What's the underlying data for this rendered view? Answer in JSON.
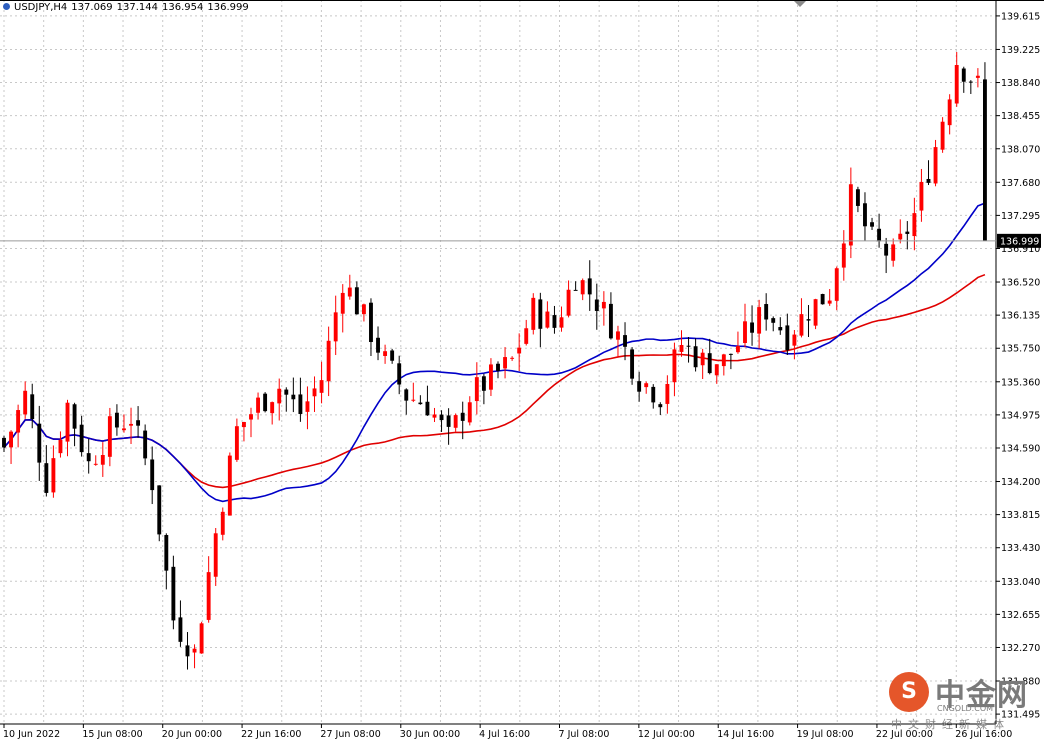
{
  "header": {
    "symbol": "USDJPY,H4",
    "open": "137.069",
    "high": "137.144",
    "low": "136.954",
    "close": "136.999"
  },
  "watermark": {
    "title": "中金网",
    "url": "CNGOLD.COM",
    "subtitle": "中文财经新媒体",
    "logo_glyph": "S"
  },
  "colors": {
    "bull": "#ff0000",
    "bear": "#000000",
    "ma_fast": "#0000c8",
    "ma_slow": "#e00000",
    "grid": "#c8c8c8",
    "current_badge_bg": "#000000",
    "current_badge_fg": "#ffffff"
  },
  "chart_data": {
    "type": "candlestick",
    "symbol": "USDJPY",
    "timeframe": "H4",
    "current_price": 136.999,
    "y_ticks": [
      "139.615",
      "139.225",
      "138.840",
      "138.455",
      "138.070",
      "137.680",
      "137.295",
      "136.910",
      "136.520",
      "136.135",
      "135.750",
      "135.360",
      "134.975",
      "134.590",
      "134.200",
      "133.815",
      "133.430",
      "133.040",
      "132.655",
      "132.270",
      "131.880",
      "131.495"
    ],
    "ylim": [
      131.38,
      139.8
    ],
    "x_ticks": [
      "10 Jun 2022",
      "15 Jun 08:00",
      "20 Jun 00:00",
      "22 Jun 16:00",
      "27 Jun 08:00",
      "30 Jun 00:00",
      "4 Jul 16:00",
      "7 Jul 08:00",
      "12 Jul 00:00",
      "14 Jul 16:00",
      "19 Jul 08:00",
      "22 Jul 00:00",
      "26 Jul 16:00"
    ],
    "candle_count": 140,
    "key_closes": [
      [
        0,
        134.6
      ],
      [
        3,
        135.2
      ],
      [
        6,
        134.2
      ],
      [
        9,
        135.1
      ],
      [
        12,
        134.4
      ],
      [
        15,
        134.8
      ],
      [
        18,
        134.95
      ],
      [
        21,
        134.2
      ],
      [
        24,
        132.6
      ],
      [
        27,
        132.2
      ],
      [
        30,
        133.6
      ],
      [
        33,
        134.8
      ],
      [
        36,
        135.1
      ],
      [
        39,
        135.3
      ],
      [
        42,
        135.0
      ],
      [
        45,
        135.4
      ],
      [
        48,
        136.55
      ],
      [
        51,
        136.1
      ],
      [
        54,
        135.6
      ],
      [
        57,
        135.2
      ],
      [
        60,
        135.1
      ],
      [
        63,
        134.7
      ],
      [
        66,
        135.2
      ],
      [
        69,
        135.4
      ],
      [
        72,
        135.6
      ],
      [
        75,
        136.2
      ],
      [
        78,
        136.0
      ],
      [
        81,
        136.6
      ],
      [
        84,
        136.3
      ],
      [
        87,
        135.9
      ],
      [
        90,
        135.4
      ],
      [
        93,
        135.2
      ],
      [
        96,
        135.8
      ],
      [
        99,
        135.6
      ],
      [
        102,
        135.6
      ],
      [
        105,
        135.9
      ],
      [
        108,
        136.2
      ],
      [
        111,
        135.9
      ],
      [
        114,
        136.2
      ],
      [
        117,
        136.4
      ],
      [
        120,
        137.5
      ],
      [
        123,
        137.0
      ],
      [
        126,
        136.8
      ],
      [
        129,
        137.3
      ],
      [
        132,
        138.1
      ],
      [
        135,
        139.1
      ],
      [
        138,
        138.8
      ],
      [
        140,
        138.3
      ]
    ],
    "indicators": [
      {
        "type": "moving-average",
        "color": "blue"
      },
      {
        "type": "moving-average",
        "color": "red"
      }
    ],
    "grid": true
  }
}
